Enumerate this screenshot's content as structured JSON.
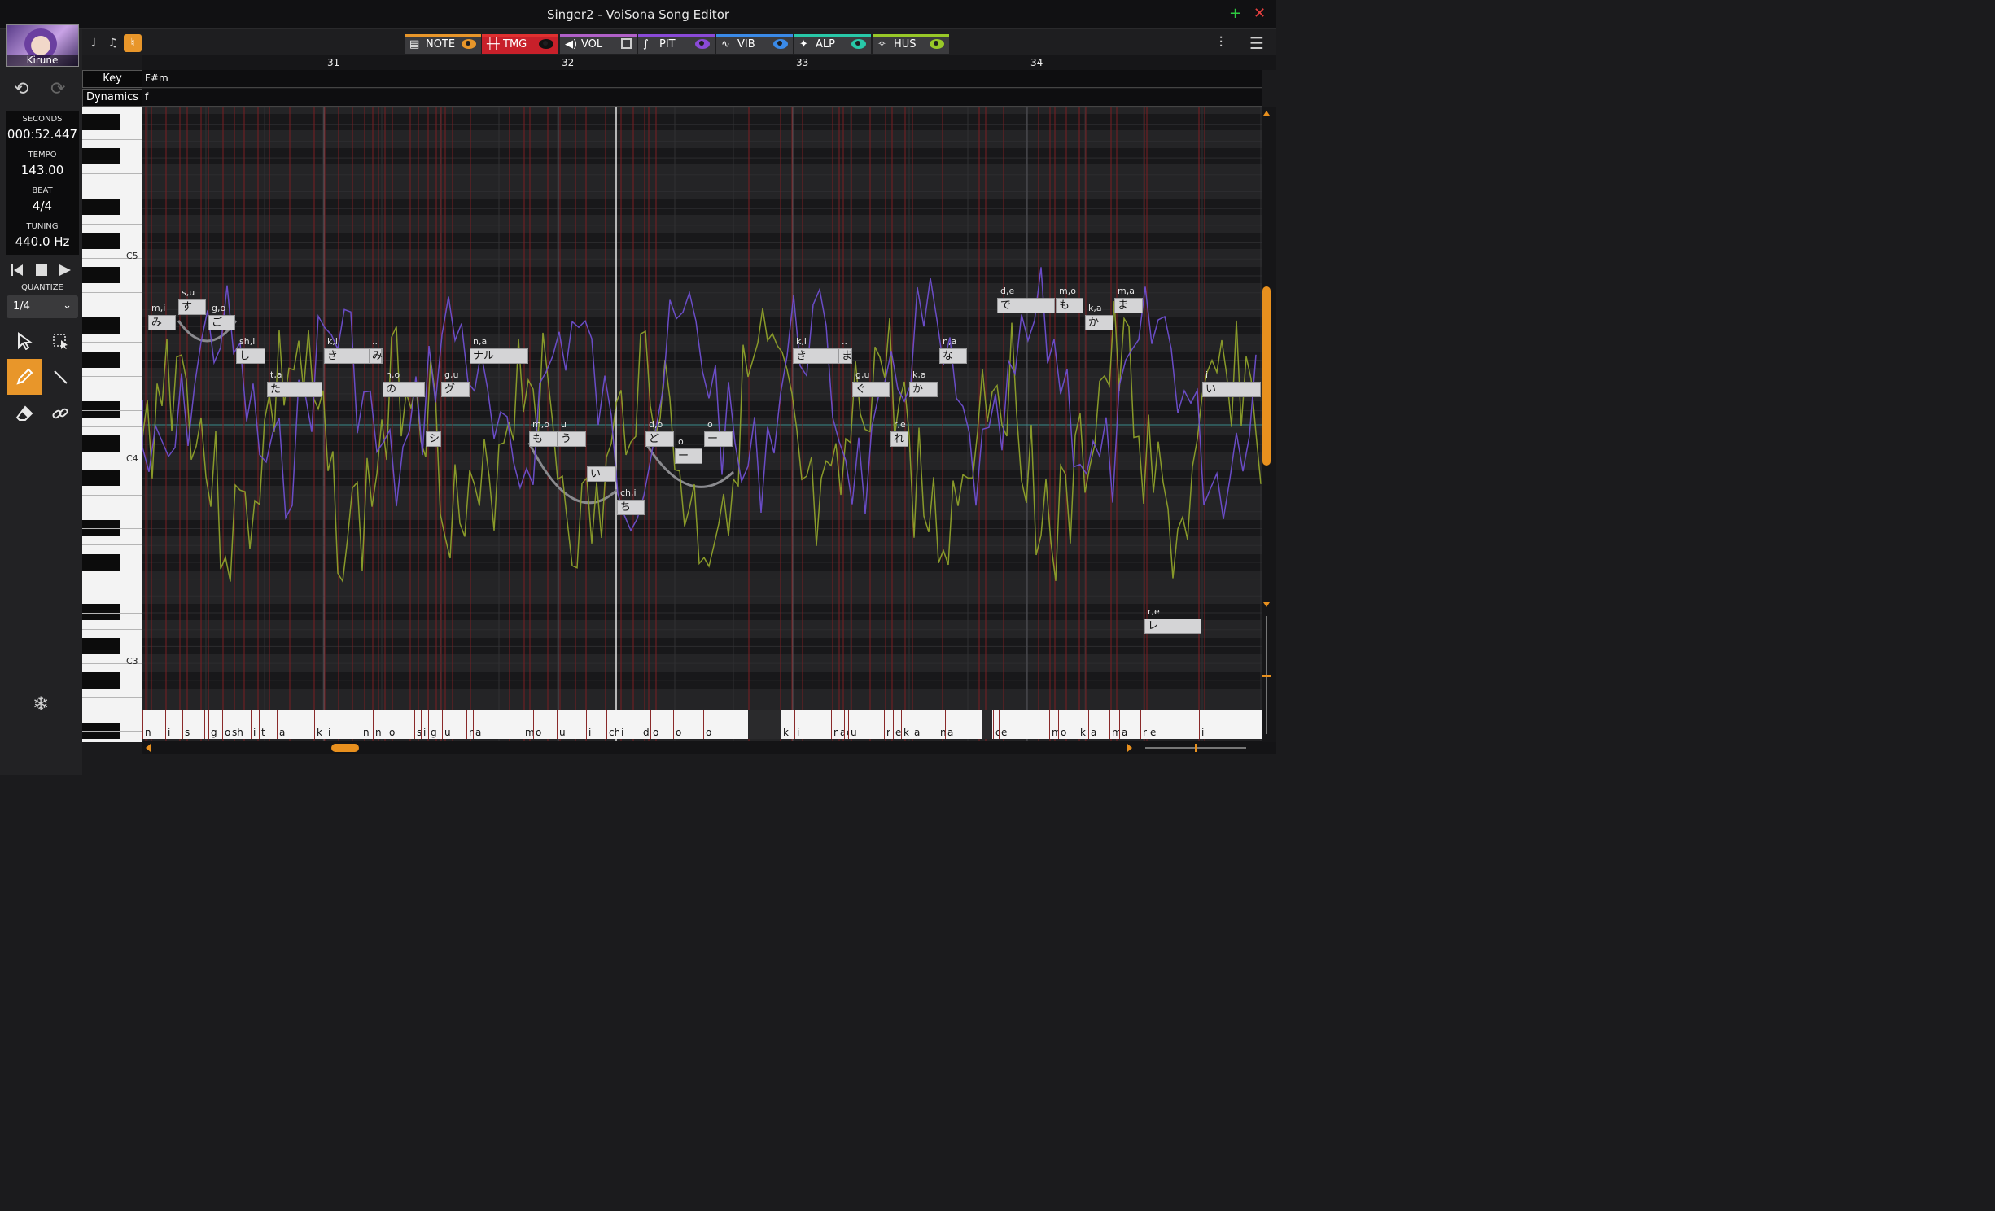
{
  "window": {
    "title": "Singer2 - VoiSona Song Editor"
  },
  "singer": {
    "name": "Kirune"
  },
  "info": {
    "seconds_label": "SECONDS",
    "seconds_value": "000:52.447",
    "tempo_label": "TEMPO",
    "tempo_value": "143.00",
    "beat_label": "BEAT",
    "beat_value": "4/4",
    "tuning_label": "TUNING",
    "tuning_value": "440.0 Hz"
  },
  "quantize": {
    "label": "QUANTIZE",
    "value": "1/4"
  },
  "tabs": [
    {
      "id": "note",
      "label": "NOTE",
      "color": "#e8962a"
    },
    {
      "id": "tmg",
      "label": "TMG",
      "color": "#e03030"
    },
    {
      "id": "vol",
      "label": "VOL",
      "color": "#b060c8"
    },
    {
      "id": "pit",
      "label": "PIT",
      "color": "#8a4ad8"
    },
    {
      "id": "vib",
      "label": "VIB",
      "color": "#3a8ae8"
    },
    {
      "id": "alp",
      "label": "ALP",
      "color": "#28c8a8"
    },
    {
      "id": "hus",
      "label": "HUS",
      "color": "#98c828"
    }
  ],
  "ruler": {
    "bars": [
      "31",
      "32",
      "33",
      "34"
    ]
  },
  "lanes": {
    "key_label": "Key",
    "key_value": "F#m",
    "dynamics_label": "Dynamics",
    "dynamics_value": "f"
  },
  "piano": {
    "labels": [
      "C5",
      "C4",
      "C3"
    ]
  },
  "notes": [
    {
      "ph": "m,i",
      "lyric": "み"
    },
    {
      "ph": "s,u",
      "lyric": "す"
    },
    {
      "ph": "g,o",
      "lyric": "ご"
    },
    {
      "ph": "sh,i",
      "lyric": "し"
    },
    {
      "ph": "t,a",
      "lyric": "た"
    },
    {
      "ph": "k,i",
      "lyric": "き"
    },
    {
      "ph": "..",
      "lyric": "み"
    },
    {
      "ph": "n,o",
      "lyric": "の"
    },
    {
      "ph": "",
      "lyric": "シ"
    },
    {
      "ph": "g,u",
      "lyric": "グ"
    },
    {
      "ph": "n,a",
      "lyric": "ナル"
    },
    {
      "ph": "m,o",
      "lyric": "も"
    },
    {
      "ph": "u",
      "lyric": "う"
    },
    {
      "ph": "",
      "lyric": "い"
    },
    {
      "ph": "ch,i",
      "lyric": "ち"
    },
    {
      "ph": "d,o",
      "lyric": "ど"
    },
    {
      "ph": "o",
      "lyric": "ー"
    },
    {
      "ph": "o",
      "lyric": "ー"
    },
    {
      "ph": "k,i",
      "lyric": "き"
    },
    {
      "ph": "..",
      "lyric": "ま"
    },
    {
      "ph": "g,u",
      "lyric": "ぐ"
    },
    {
      "ph": "r,e",
      "lyric": "れ"
    },
    {
      "ph": "k,a",
      "lyric": "か"
    },
    {
      "ph": "n,a",
      "lyric": "な"
    },
    {
      "ph": "d,e",
      "lyric": "で"
    },
    {
      "ph": "m,o",
      "lyric": "も"
    },
    {
      "ph": "k,a",
      "lyric": "か"
    },
    {
      "ph": "m,a",
      "lyric": "ま"
    },
    {
      "ph": "r,e",
      "lyric": "レ"
    },
    {
      "ph": "i",
      "lyric": "い"
    }
  ],
  "phonemes": [
    "n",
    "i",
    "s",
    "u",
    "g",
    "o",
    "sh",
    "i",
    "t",
    "a",
    "k",
    "i",
    "n",
    "i",
    "n",
    "o",
    "sh",
    "i",
    "g",
    "u",
    "n",
    "a",
    "m",
    "o",
    "u",
    "i",
    "ch",
    "i",
    "d",
    "o",
    "o",
    "o",
    "k",
    "i",
    "n",
    "a",
    "g",
    "u",
    "r",
    "e",
    "k",
    "a",
    "n",
    "a",
    "d",
    "e",
    "m",
    "o",
    "k",
    "a",
    "m",
    "a",
    "r",
    "e",
    "i"
  ]
}
